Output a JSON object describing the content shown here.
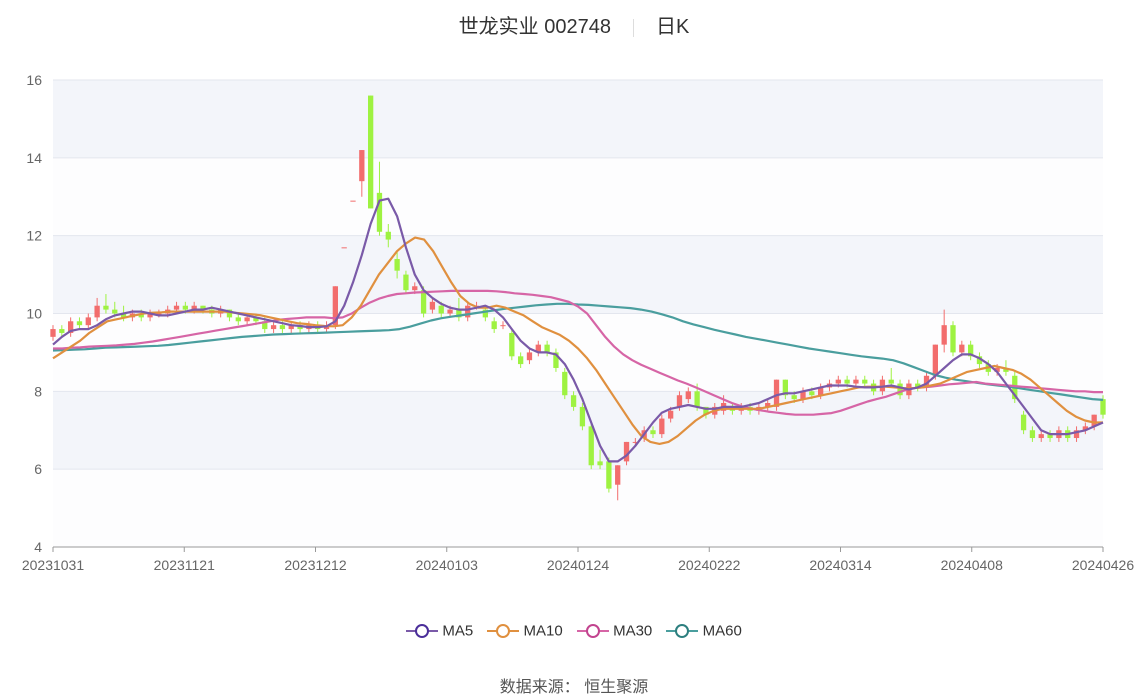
{
  "header": {
    "name": "世龙实业 002748",
    "period": "日K"
  },
  "source": "数据来源： 恒生聚源",
  "colors": {
    "up": "#f26d6d",
    "down": "#9ef241",
    "MA5": "#7a5aa8",
    "MA10": "#e0903f",
    "MA30": "#d665a6",
    "MA60": "#4a9e9e",
    "band": "#f3f5fa"
  },
  "chart_data": {
    "type": "candlestick",
    "title": "世龙实业 002748 日K",
    "x_ticks": [
      "20231031",
      "20231121",
      "20231212",
      "20240103",
      "20240124",
      "20240222",
      "20240314",
      "20240408",
      "20240426"
    ],
    "ylim": [
      4,
      16
    ],
    "y_ticks": [
      "4",
      "6",
      "8",
      "10",
      "12",
      "14",
      "16"
    ],
    "legend": [
      "MA5",
      "MA10",
      "MA30",
      "MA60"
    ],
    "legend_position": "bottom",
    "candles": [
      [
        9.4,
        9.6,
        9.3,
        9.7
      ],
      [
        9.6,
        9.5,
        9.4,
        9.7
      ],
      [
        9.5,
        9.8,
        9.4,
        9.9
      ],
      [
        9.8,
        9.7,
        9.6,
        9.9
      ],
      [
        9.7,
        9.9,
        9.6,
        10.0
      ],
      [
        9.9,
        10.2,
        9.8,
        10.4
      ],
      [
        10.2,
        10.1,
        10.0,
        10.5
      ],
      [
        10.1,
        10.0,
        9.9,
        10.3
      ],
      [
        10.0,
        9.9,
        9.8,
        10.2
      ],
      [
        9.9,
        10.0,
        9.8,
        10.1
      ],
      [
        10.0,
        9.9,
        9.8,
        10.1
      ],
      [
        9.9,
        10.0,
        9.8,
        10.1
      ],
      [
        10.0,
        10.0,
        9.9,
        10.1
      ],
      [
        10.0,
        10.1,
        9.9,
        10.2
      ],
      [
        10.1,
        10.2,
        10.0,
        10.3
      ],
      [
        10.2,
        10.1,
        10.0,
        10.3
      ],
      [
        10.1,
        10.2,
        10.0,
        10.3
      ],
      [
        10.2,
        10.1,
        10.0,
        10.2
      ],
      [
        10.1,
        10.0,
        9.9,
        10.2
      ],
      [
        10.0,
        10.1,
        9.9,
        10.2
      ],
      [
        10.1,
        9.9,
        9.8,
        10.1
      ],
      [
        9.9,
        9.8,
        9.7,
        10.0
      ],
      [
        9.8,
        9.9,
        9.7,
        10.0
      ],
      [
        9.9,
        9.8,
        9.7,
        10.0
      ],
      [
        9.8,
        9.6,
        9.5,
        9.9
      ],
      [
        9.6,
        9.7,
        9.5,
        9.8
      ],
      [
        9.7,
        9.6,
        9.5,
        9.8
      ],
      [
        9.6,
        9.7,
        9.5,
        9.8
      ],
      [
        9.7,
        9.6,
        9.5,
        9.8
      ],
      [
        9.6,
        9.7,
        9.5,
        9.8
      ],
      [
        9.7,
        9.6,
        9.5,
        9.8
      ],
      [
        9.6,
        9.7,
        9.5,
        9.8
      ],
      [
        9.7,
        10.7,
        9.6,
        10.7
      ],
      [
        11.7,
        11.7,
        11.7,
        11.7
      ],
      [
        12.9,
        12.9,
        12.9,
        12.9
      ],
      [
        13.4,
        14.2,
        13.0,
        14.2
      ],
      [
        15.6,
        12.7,
        12.7,
        15.6
      ],
      [
        13.1,
        12.1,
        12.0,
        13.9
      ],
      [
        12.1,
        11.9,
        11.7,
        12.3
      ],
      [
        11.4,
        11.1,
        10.9,
        11.6
      ],
      [
        11.0,
        10.6,
        10.5,
        11.1
      ],
      [
        10.6,
        10.7,
        10.5,
        10.8
      ],
      [
        10.6,
        10.0,
        9.9,
        10.7
      ],
      [
        10.1,
        10.3,
        10.0,
        10.4
      ],
      [
        10.2,
        10.0,
        9.9,
        10.3
      ],
      [
        10.0,
        10.1,
        9.9,
        10.2
      ],
      [
        10.1,
        9.9,
        9.8,
        10.4
      ],
      [
        9.9,
        10.2,
        9.8,
        10.3
      ],
      [
        10.2,
        10.2,
        10.1,
        10.3
      ],
      [
        10.1,
        9.9,
        9.8,
        10.2
      ],
      [
        9.8,
        9.6,
        9.5,
        9.9
      ],
      [
        9.7,
        9.7,
        9.6,
        9.8
      ],
      [
        9.5,
        8.9,
        8.8,
        9.6
      ],
      [
        8.9,
        8.7,
        8.6,
        9.0
      ],
      [
        8.8,
        9.0,
        8.7,
        9.1
      ],
      [
        9.0,
        9.2,
        8.9,
        9.3
      ],
      [
        9.2,
        9.0,
        8.9,
        9.3
      ],
      [
        9.0,
        8.6,
        8.5,
        9.1
      ],
      [
        8.5,
        7.9,
        7.8,
        8.6
      ],
      [
        7.9,
        7.6,
        7.5,
        8.0
      ],
      [
        7.6,
        7.1,
        7.0,
        7.7
      ],
      [
        7.1,
        6.1,
        6.0,
        7.2
      ],
      [
        6.2,
        6.1,
        6.0,
        6.5
      ],
      [
        6.2,
        5.5,
        5.4,
        6.3
      ],
      [
        5.6,
        6.1,
        5.2,
        6.1
      ],
      [
        6.2,
        6.7,
        6.1,
        6.7
      ],
      [
        6.7,
        6.7,
        6.6,
        6.8
      ],
      [
        6.8,
        7.0,
        6.7,
        7.1
      ],
      [
        7.0,
        6.9,
        6.8,
        7.1
      ],
      [
        6.9,
        7.3,
        6.8,
        7.4
      ],
      [
        7.3,
        7.5,
        7.2,
        7.6
      ],
      [
        7.6,
        7.9,
        7.5,
        8.0
      ],
      [
        7.8,
        8.0,
        7.7,
        8.1
      ],
      [
        8.0,
        7.6,
        7.5,
        8.2
      ],
      [
        7.6,
        7.4,
        7.3,
        7.6
      ],
      [
        7.4,
        7.6,
        7.3,
        7.7
      ],
      [
        7.5,
        7.7,
        7.4,
        7.9
      ],
      [
        7.6,
        7.5,
        7.4,
        7.7
      ],
      [
        7.5,
        7.6,
        7.4,
        7.7
      ],
      [
        7.6,
        7.5,
        7.4,
        7.7
      ],
      [
        7.5,
        7.6,
        7.4,
        7.7
      ],
      [
        7.6,
        7.7,
        7.5,
        7.8
      ],
      [
        7.6,
        8.3,
        7.5,
        8.3
      ],
      [
        8.3,
        7.9,
        7.8,
        8.3
      ],
      [
        7.9,
        7.8,
        7.7,
        8.0
      ],
      [
        7.8,
        8.0,
        7.7,
        8.1
      ],
      [
        8.0,
        7.9,
        7.8,
        8.1
      ],
      [
        7.9,
        8.1,
        7.8,
        8.2
      ],
      [
        8.1,
        8.2,
        8.0,
        8.3
      ],
      [
        8.2,
        8.3,
        8.1,
        8.4
      ],
      [
        8.3,
        8.2,
        8.1,
        8.4
      ],
      [
        8.2,
        8.3,
        8.1,
        8.4
      ],
      [
        8.3,
        8.2,
        8.1,
        8.4
      ],
      [
        8.2,
        8.0,
        7.9,
        8.3
      ],
      [
        8.0,
        8.3,
        7.9,
        8.4
      ],
      [
        8.3,
        8.2,
        8.1,
        8.6
      ],
      [
        8.2,
        7.9,
        7.8,
        8.3
      ],
      [
        7.9,
        8.2,
        7.8,
        8.3
      ],
      [
        8.2,
        8.1,
        8.0,
        8.3
      ],
      [
        8.1,
        8.4,
        8.0,
        8.5
      ],
      [
        8.4,
        9.2,
        8.3,
        9.2
      ],
      [
        9.2,
        9.7,
        9.0,
        10.1
      ],
      [
        9.7,
        9.0,
        8.9,
        9.8
      ],
      [
        9.0,
        9.2,
        8.9,
        9.3
      ],
      [
        9.2,
        8.9,
        8.8,
        9.3
      ],
      [
        8.9,
        8.7,
        8.6,
        9.0
      ],
      [
        8.7,
        8.5,
        8.4,
        8.8
      ],
      [
        8.5,
        8.6,
        8.4,
        8.7
      ],
      [
        8.6,
        8.5,
        8.4,
        8.8
      ],
      [
        8.4,
        7.8,
        7.7,
        8.5
      ],
      [
        7.4,
        7.0,
        6.9,
        7.5
      ],
      [
        7.0,
        6.8,
        6.7,
        7.1
      ],
      [
        6.8,
        6.9,
        6.7,
        7.0
      ],
      [
        6.9,
        6.8,
        6.7,
        7.0
      ],
      [
        6.8,
        7.0,
        6.7,
        7.1
      ],
      [
        7.0,
        6.8,
        6.7,
        7.1
      ],
      [
        6.8,
        7.0,
        6.7,
        7.1
      ],
      [
        7.0,
        7.1,
        6.9,
        7.2
      ],
      [
        7.1,
        7.4,
        7.0,
        7.4
      ],
      [
        7.8,
        7.4,
        7.3,
        7.9
      ]
    ],
    "ma": {
      "MA5": [
        9.2,
        9.4,
        9.55,
        9.6,
        9.6,
        9.7,
        9.85,
        9.95,
        10.0,
        10.05,
        10.05,
        10.0,
        9.95,
        9.95,
        10.0,
        10.05,
        10.1,
        10.1,
        10.15,
        10.1,
        10.05,
        10.0,
        9.95,
        9.9,
        9.85,
        9.8,
        9.75,
        9.7,
        9.68,
        9.65,
        9.65,
        9.67,
        9.8,
        10.2,
        10.8,
        11.5,
        12.3,
        12.9,
        12.95,
        12.5,
        11.7,
        11.0,
        10.6,
        10.4,
        10.25,
        10.15,
        10.1,
        10.1,
        10.15,
        10.2,
        10.1,
        9.9,
        9.6,
        9.3,
        9.1,
        9.0,
        9.0,
        8.95,
        8.7,
        8.3,
        7.8,
        7.2,
        6.6,
        6.2,
        6.2,
        6.35,
        6.6,
        6.9,
        7.2,
        7.45,
        7.55,
        7.6,
        7.65,
        7.6,
        7.55,
        7.55,
        7.6,
        7.6,
        7.6,
        7.65,
        7.7,
        7.8,
        7.9,
        7.95,
        7.95,
        8.0,
        8.05,
        8.1,
        8.15,
        8.15,
        8.15,
        8.12,
        8.1,
        8.1,
        8.12,
        8.15,
        8.1,
        8.05,
        8.1,
        8.2,
        8.4,
        8.6,
        8.8,
        8.95,
        8.95,
        8.85,
        8.7,
        8.5,
        8.2,
        7.9,
        7.6,
        7.3,
        7.0,
        6.9,
        6.9,
        6.9,
        6.95,
        7.0,
        7.1,
        7.2
      ],
      "MA10": [
        8.85,
        9.0,
        9.15,
        9.3,
        9.5,
        9.65,
        9.8,
        9.85,
        9.9,
        9.95,
        10.0,
        10.02,
        10.03,
        10.05,
        10.05,
        10.05,
        10.05,
        10.05,
        10.05,
        10.05,
        10.02,
        10.0,
        9.98,
        9.95,
        9.9,
        9.85,
        9.8,
        9.75,
        9.73,
        9.7,
        9.68,
        9.67,
        9.7,
        9.9,
        10.2,
        10.6,
        11.0,
        11.3,
        11.6,
        11.8,
        11.95,
        11.9,
        11.6,
        11.2,
        10.8,
        10.45,
        10.25,
        10.15,
        10.15,
        10.2,
        10.15,
        10.05,
        9.95,
        9.8,
        9.65,
        9.55,
        9.45,
        9.3,
        9.1,
        8.85,
        8.55,
        8.2,
        7.85,
        7.5,
        7.15,
        6.85,
        6.7,
        6.65,
        6.7,
        6.85,
        7.05,
        7.25,
        7.4,
        7.5,
        7.55,
        7.55,
        7.55,
        7.55,
        7.55,
        7.6,
        7.65,
        7.7,
        7.75,
        7.8,
        7.85,
        7.9,
        7.95,
        8.0,
        8.05,
        8.1,
        8.12,
        8.12,
        8.12,
        8.1,
        8.08,
        8.08,
        8.1,
        8.15,
        8.2,
        8.3,
        8.4,
        8.5,
        8.55,
        8.6,
        8.65,
        8.6,
        8.55,
        8.45,
        8.3,
        8.1,
        7.9,
        7.7,
        7.5,
        7.35,
        7.25,
        7.2,
        7.2
      ],
      "MA30": [
        9.1,
        9.1,
        9.12,
        9.13,
        9.15,
        9.16,
        9.17,
        9.18,
        9.2,
        9.22,
        9.25,
        9.28,
        9.32,
        9.36,
        9.4,
        9.44,
        9.48,
        9.52,
        9.56,
        9.6,
        9.64,
        9.68,
        9.72,
        9.76,
        9.8,
        9.84,
        9.86,
        9.88,
        9.9,
        9.9,
        9.9,
        9.88,
        9.9,
        10.0,
        10.15,
        10.28,
        10.38,
        10.45,
        10.5,
        10.52,
        10.54,
        10.55,
        10.56,
        10.57,
        10.58,
        10.58,
        10.58,
        10.58,
        10.58,
        10.57,
        10.55,
        10.52,
        10.5,
        10.48,
        10.45,
        10.42,
        10.36,
        10.3,
        10.18,
        10.0,
        9.7,
        9.4,
        9.15,
        8.95,
        8.8,
        8.68,
        8.58,
        8.48,
        8.38,
        8.28,
        8.2,
        8.1,
        8.0,
        7.9,
        7.8,
        7.7,
        7.62,
        7.56,
        7.52,
        7.48,
        7.45,
        7.42,
        7.4,
        7.4,
        7.4,
        7.42,
        7.44,
        7.5,
        7.58,
        7.66,
        7.74,
        7.8,
        7.86,
        7.94,
        8.02,
        8.08,
        8.1,
        8.12,
        8.15,
        8.18,
        8.2,
        8.22,
        8.24,
        8.2,
        8.18,
        8.16,
        8.14,
        8.12,
        8.1,
        8.08,
        8.06,
        8.04,
        8.02,
        8.0,
        8.0,
        7.98,
        7.98
      ],
      "MA60": [
        9.05,
        9.06,
        9.07,
        9.08,
        9.1,
        9.12,
        9.13,
        9.14,
        9.15,
        9.16,
        9.17,
        9.19,
        9.22,
        9.25,
        9.28,
        9.31,
        9.34,
        9.37,
        9.4,
        9.42,
        9.44,
        9.46,
        9.47,
        9.48,
        9.49,
        9.5,
        9.51,
        9.52,
        9.53,
        9.54,
        9.55,
        9.56,
        9.57,
        9.6,
        9.66,
        9.74,
        9.82,
        9.88,
        9.92,
        9.96,
        10.0,
        10.04,
        10.08,
        10.12,
        10.15,
        10.18,
        10.21,
        10.23,
        10.25,
        10.25,
        10.23,
        10.22,
        10.2,
        10.18,
        10.16,
        10.14,
        10.1,
        10.05,
        9.98,
        9.9,
        9.8,
        9.72,
        9.65,
        9.58,
        9.52,
        9.46,
        9.4,
        9.35,
        9.3,
        9.25,
        9.2,
        9.15,
        9.1,
        9.06,
        9.02,
        8.98,
        8.94,
        8.9,
        8.87,
        8.84,
        8.8,
        8.72,
        8.62,
        8.52,
        8.42,
        8.35,
        8.3,
        8.26,
        8.22,
        8.18,
        8.15,
        8.12,
        8.08,
        8.04,
        8.0,
        7.96,
        7.92,
        7.88,
        7.84,
        7.8,
        7.78
      ]
    }
  }
}
